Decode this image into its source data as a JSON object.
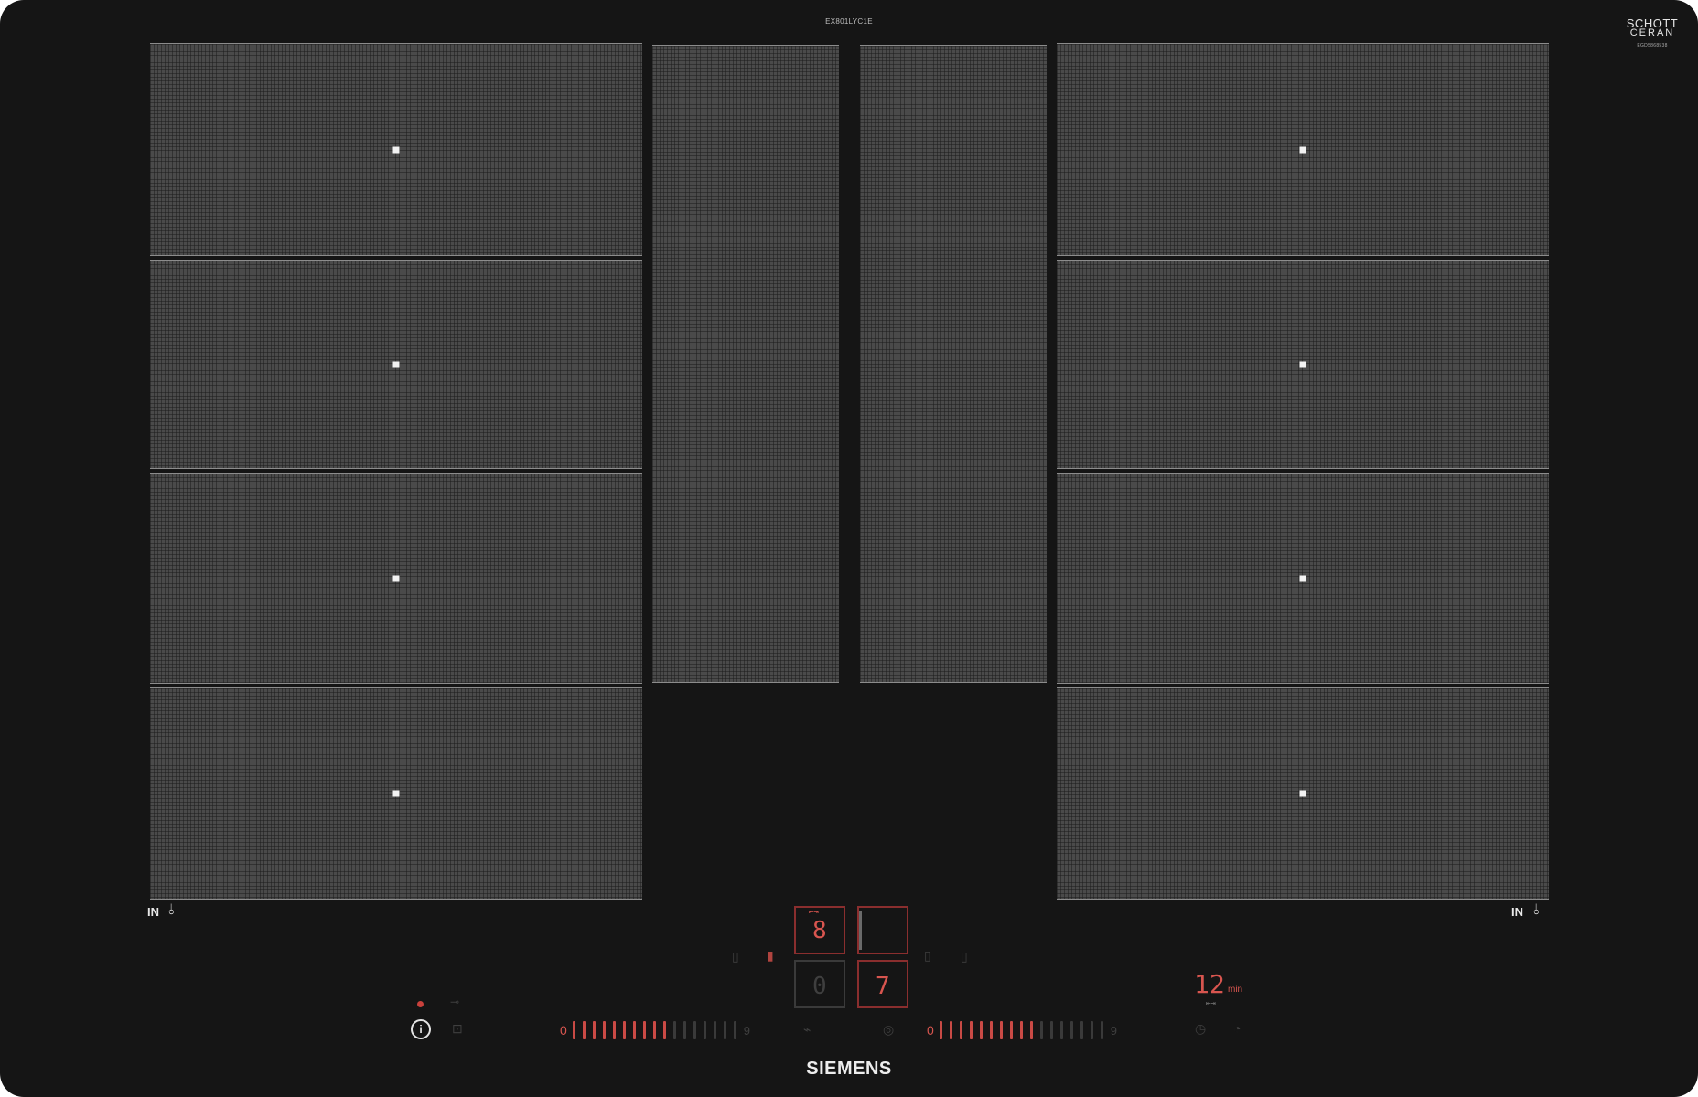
{
  "product": {
    "model_code": "EX801LYC1E",
    "glass_brand_line1": "SCHOTT",
    "glass_brand_line2": "CERAN",
    "glass_code": "EGD5868538",
    "brand": "SIEMENS"
  },
  "flex_zone_labels": {
    "left": "IN",
    "right": "IN"
  },
  "displays": {
    "zone_top_left_value": "8",
    "zone_top_left_symbol": "⇤⇥",
    "zone_bottom_left_value": "0",
    "zone_bottom_right_value": "7",
    "timer_value": "12",
    "timer_unit": "min",
    "timer_symbol": "⇤⇥"
  },
  "sliders": {
    "left": {
      "start_label": "0",
      "end_label": "9",
      "lit_fraction": 0.6
    },
    "right": {
      "start_label": "0",
      "end_label": "9",
      "lit_fraction": 0.6
    }
  },
  "icons": {
    "power": "power-info-icon",
    "lock": "child-lock-icon",
    "indicator": "red-indicator-dot",
    "timer_clock": "timer-clock-icon"
  },
  "colors": {
    "glass": "#151515",
    "zone": "#4a4a4a",
    "display_red": "#d8554f"
  }
}
